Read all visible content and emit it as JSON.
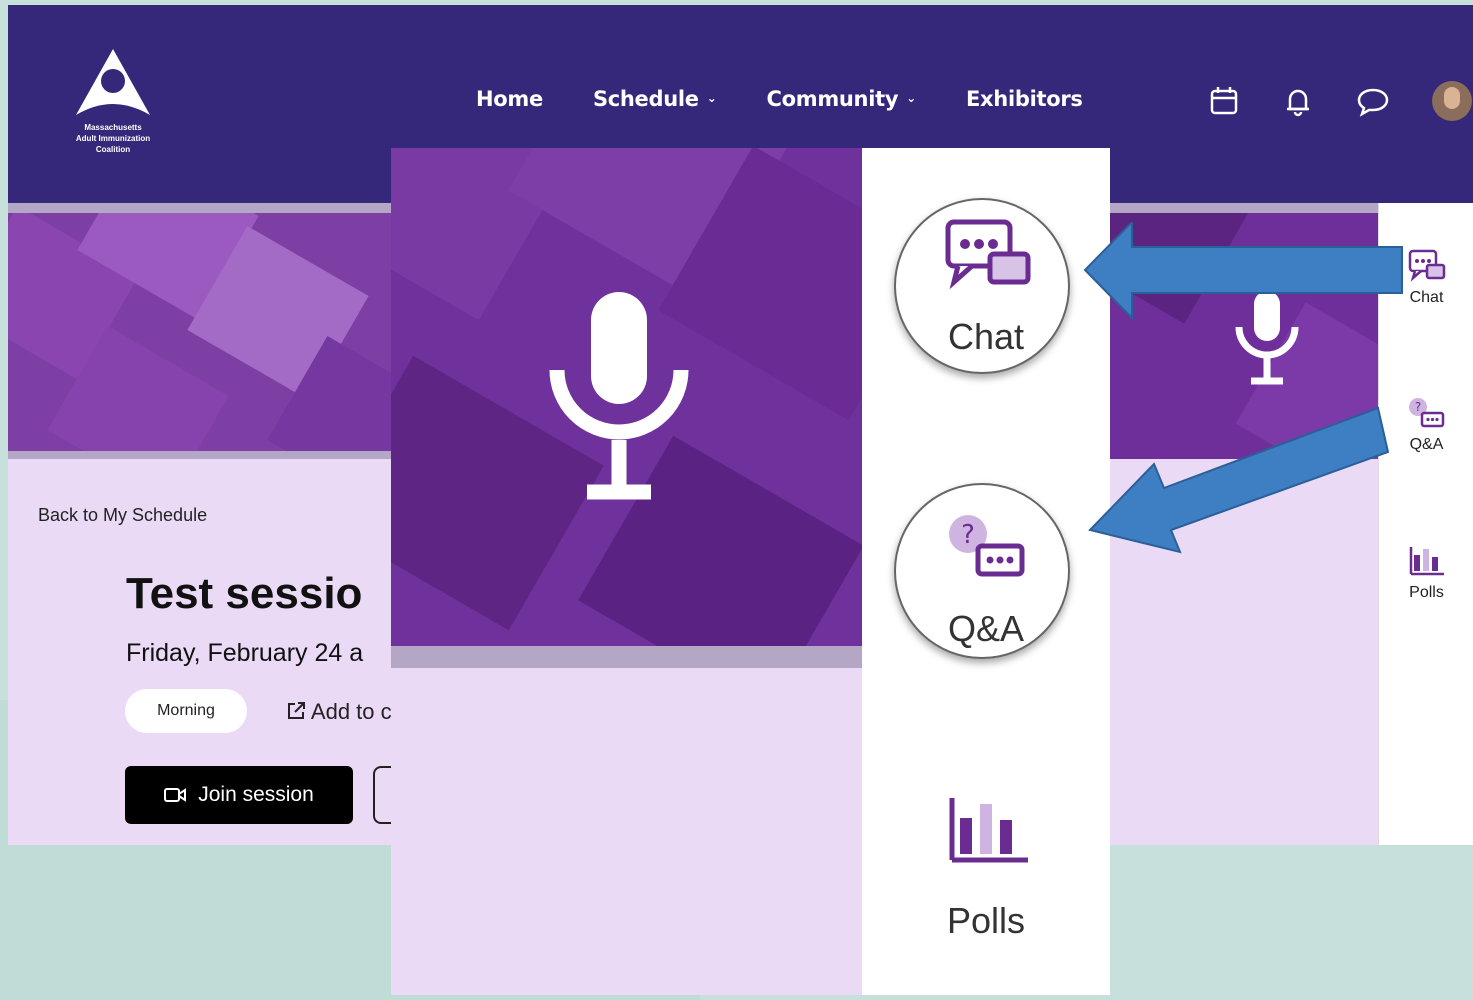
{
  "logo": {
    "line1": "Massachusetts",
    "line2": "Adult Immunization",
    "line3": "Coalition"
  },
  "nav": {
    "home": "Home",
    "schedule": "Schedule",
    "community": "Community",
    "exhibitors": "Exhibitors",
    "icons": [
      "calendar-icon",
      "bell-icon",
      "chat-bubble-icon",
      "user-avatar"
    ]
  },
  "session": {
    "back_link": "Back to My Schedule",
    "title": "Test sessio",
    "date": "Friday, February 24 a",
    "tag": "Morning",
    "add_to_calendar": "Add to c",
    "join_button": "Join session"
  },
  "sidebar": {
    "chat": "Chat",
    "qa": "Q&A",
    "polls": "Polls"
  },
  "zoom": {
    "chat": "Chat",
    "qa": "Q&A",
    "polls": "Polls"
  },
  "colors": {
    "nav": "#35277a",
    "accent": "#7e3fa5",
    "arrow": "#3e7fc4",
    "content_bg": "#eadaf6"
  }
}
